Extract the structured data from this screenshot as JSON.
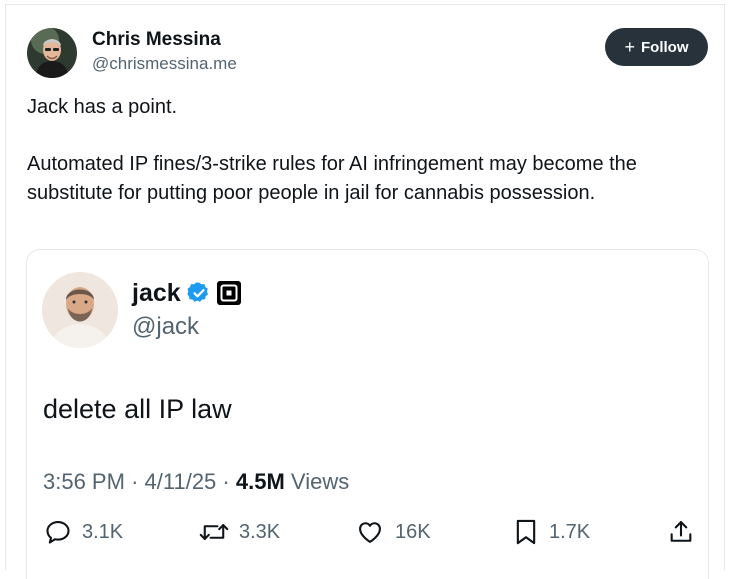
{
  "author": {
    "name": "Chris Messina",
    "handle": "@chrismessina.me"
  },
  "follow_button": {
    "plus": "+",
    "label": "Follow"
  },
  "post": {
    "line1": "Jack has a point.",
    "line2": "Automated IP fines/3-strike rules for AI infringement may become the substitute for putting poor people in jail for cannabis possession."
  },
  "quote": {
    "name": "jack",
    "handle": "@jack",
    "text": "delete all IP law",
    "time": "3:56 PM",
    "date": "4/11/25",
    "separator": "·",
    "views_count": "4.5M",
    "views_label": "Views",
    "verified": true
  },
  "actions": {
    "replies": "3.1K",
    "reposts": "3.3K",
    "likes": "16K",
    "bookmarks": "1.7K"
  },
  "colors": {
    "follow_bg": "#27323b",
    "verified_blue": "#1d9bf0",
    "secondary_text": "#536471",
    "primary_text": "#0f1419"
  }
}
